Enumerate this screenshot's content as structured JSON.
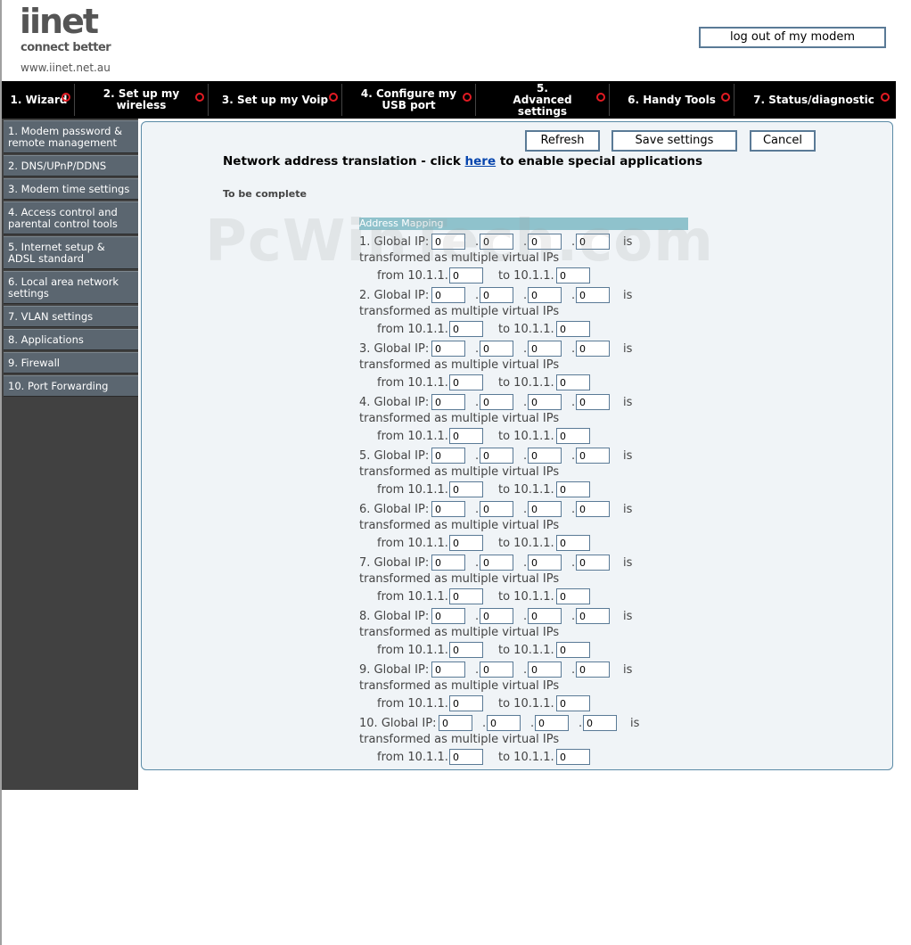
{
  "header": {
    "logo_text": "iinet",
    "logo_tagline": "connect better",
    "logo_url": "www.iinet.net.au",
    "logout_label": "log out of my modem"
  },
  "topnav": [
    {
      "label": "1. Wizard"
    },
    {
      "label": "2. Set up my wireless"
    },
    {
      "label": "3. Set up my Voip"
    },
    {
      "label": "4. Configure my USB port"
    },
    {
      "label": "5. Advanced settings"
    },
    {
      "label": "6. Handy Tools"
    },
    {
      "label": "7. Status/diagnostic"
    }
  ],
  "sidebar": [
    {
      "label": "1. Modem password & remote management"
    },
    {
      "label": "2. DNS/UPnP/DDNS"
    },
    {
      "label": "3. Modem time settings"
    },
    {
      "label": "4. Access control and parental control tools"
    },
    {
      "label": "5. Internet setup & ADSL standard"
    },
    {
      "label": "6. Local area network settings"
    },
    {
      "label": "7. VLAN settings"
    },
    {
      "label": "8. Applications"
    },
    {
      "label": "9. Firewall"
    },
    {
      "label": "10. Port Forwarding"
    }
  ],
  "toolbar": {
    "refresh_label": "Refresh",
    "save_label": "Save settings",
    "cancel_label": "Cancel"
  },
  "content": {
    "heading_pre": "Network address translation - click ",
    "heading_link": "here",
    "heading_post": " to enable special applications",
    "subheading": "To be complete",
    "section_title": "Address Mapping",
    "watermark": "PcWinTech.com",
    "global_ip_suffix": "Global IP:",
    "is_label": "is",
    "transformed_label": "transformed as multiple virtual IPs",
    "from_label": "from 10.1.1.",
    "to_label": "to 10.1.1.",
    "dot": "."
  },
  "mappings": [
    {
      "num": "1.",
      "ip": [
        "0",
        "0",
        "0",
        "0"
      ],
      "from": "0",
      "to": "0"
    },
    {
      "num": "2.",
      "ip": [
        "0",
        "0",
        "0",
        "0"
      ],
      "from": "0",
      "to": "0"
    },
    {
      "num": "3.",
      "ip": [
        "0",
        "0",
        "0",
        "0"
      ],
      "from": "0",
      "to": "0"
    },
    {
      "num": "4.",
      "ip": [
        "0",
        "0",
        "0",
        "0"
      ],
      "from": "0",
      "to": "0"
    },
    {
      "num": "5.",
      "ip": [
        "0",
        "0",
        "0",
        "0"
      ],
      "from": "0",
      "to": "0"
    },
    {
      "num": "6.",
      "ip": [
        "0",
        "0",
        "0",
        "0"
      ],
      "from": "0",
      "to": "0"
    },
    {
      "num": "7.",
      "ip": [
        "0",
        "0",
        "0",
        "0"
      ],
      "from": "0",
      "to": "0"
    },
    {
      "num": "8.",
      "ip": [
        "0",
        "0",
        "0",
        "0"
      ],
      "from": "0",
      "to": "0"
    },
    {
      "num": "9.",
      "ip": [
        "0",
        "0",
        "0",
        "0"
      ],
      "from": "0",
      "to": "0"
    },
    {
      "num": "10.",
      "ip": [
        "0",
        "0",
        "0",
        "0"
      ],
      "from": "0",
      "to": "0"
    }
  ],
  "colors": {
    "brand_red": "#e31b23",
    "sidebar_bg": "#414141",
    "sidebar_item": "#5b6670",
    "section_header": "#8fc2cc",
    "panel_border": "#5a8aa6"
  }
}
